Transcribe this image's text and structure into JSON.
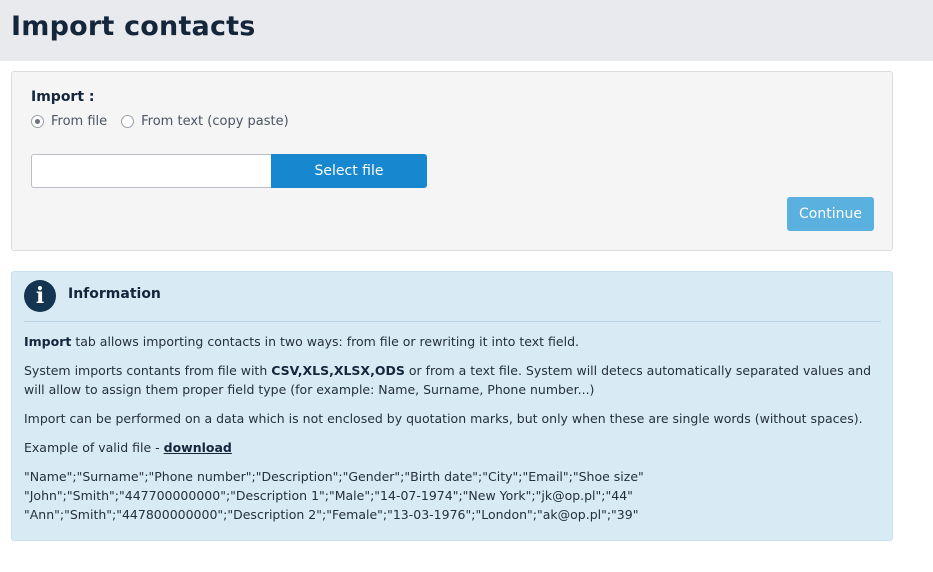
{
  "header": {
    "title": "Import contacts"
  },
  "import_form": {
    "label": "Import :",
    "options": [
      {
        "label": "From file",
        "checked": true
      },
      {
        "label": "From text (copy paste)",
        "checked": false
      }
    ],
    "file_input_value": "",
    "select_file_label": "Select file",
    "continue_label": "Continue"
  },
  "info": {
    "icon": "info-icon",
    "icon_glyph": "i",
    "title": "Information",
    "p1_bold": "Import",
    "p1_rest": " tab allows importing contacts in two ways: from file or rewriting it into text field.",
    "p2_start": "System imports contants from file with ",
    "p2_formats": [
      "CSV",
      "XLS",
      "XLSX",
      "ODS"
    ],
    "p2_sep": ",",
    "p2_rest": " or from a text file. System will detecs automatically separated values and will allow to assign them proper field type (for example: Name, Surname, Phone number...)",
    "p3": "Import can be performed on a data which is not enclosed by quotation marks, but only when these are single words (without spaces).",
    "p4_prefix": "Example of valid file - ",
    "p4_link": "download",
    "example_lines": [
      "\"Name\";\"Surname\";\"Phone number\";\"Description\";\"Gender\";\"Birth date\";\"City\";\"Email\";\"Shoe size\"",
      "\"John\";\"Smith\";\"447700000000\";\"Description 1\";\"Male\";\"14-07-1974\";\"New York\";\"jk@op.pl\";\"44\"",
      "\"Ann\";\"Smith\";\"447800000000\";\"Description 2\";\"Female\";\"13-03-1976\";\"London\";\"ak@op.pl\";\"39\""
    ]
  },
  "colors": {
    "primary": "#1787cf",
    "continue": "#5ab0de",
    "info_background": "#d8ebf5",
    "header_background": "#e9eaee"
  }
}
